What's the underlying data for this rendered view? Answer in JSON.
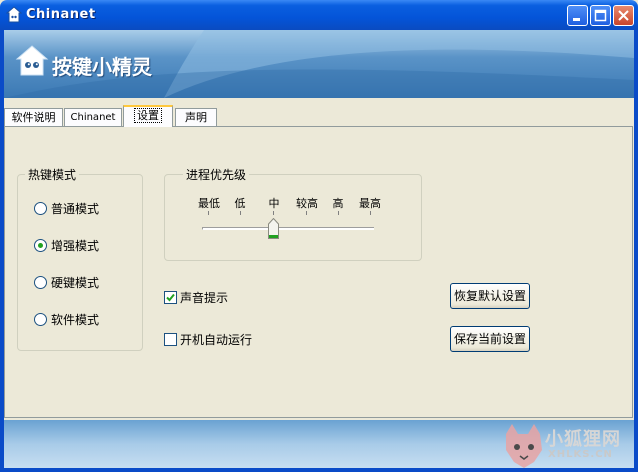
{
  "window": {
    "title": "Chinanet"
  },
  "banner": {
    "app_name": "按键小精灵"
  },
  "tabs": [
    {
      "label": "软件说明",
      "active": false
    },
    {
      "label": "Chinanet",
      "active": false
    },
    {
      "label": "设置",
      "active": true
    },
    {
      "label": "声明",
      "active": false
    }
  ],
  "hotkey_mode": {
    "title": "热键模式",
    "options": [
      {
        "label": "普通模式",
        "selected": false
      },
      {
        "label": "增强模式",
        "selected": true
      },
      {
        "label": "硬键模式",
        "selected": false
      },
      {
        "label": "软件模式",
        "selected": false
      }
    ]
  },
  "priority": {
    "title": "进程优先级",
    "levels": [
      "最低",
      "低",
      "中",
      "较高",
      "高",
      "最高"
    ],
    "selected_index": 2
  },
  "options": {
    "sound_label": "声音提示",
    "sound_checked": true,
    "autorun_label": "开机自动运行",
    "autorun_checked": false
  },
  "buttons": {
    "restore_defaults": "恢复默认设置",
    "save_current": "保存当前设置"
  },
  "watermark": {
    "text": "小狐狸网",
    "sub": "XHLKS.CN"
  },
  "colors": {
    "titlebar": "#0454d8",
    "accent_tab": "#ffc83c",
    "radio_dot": "#21a121"
  }
}
